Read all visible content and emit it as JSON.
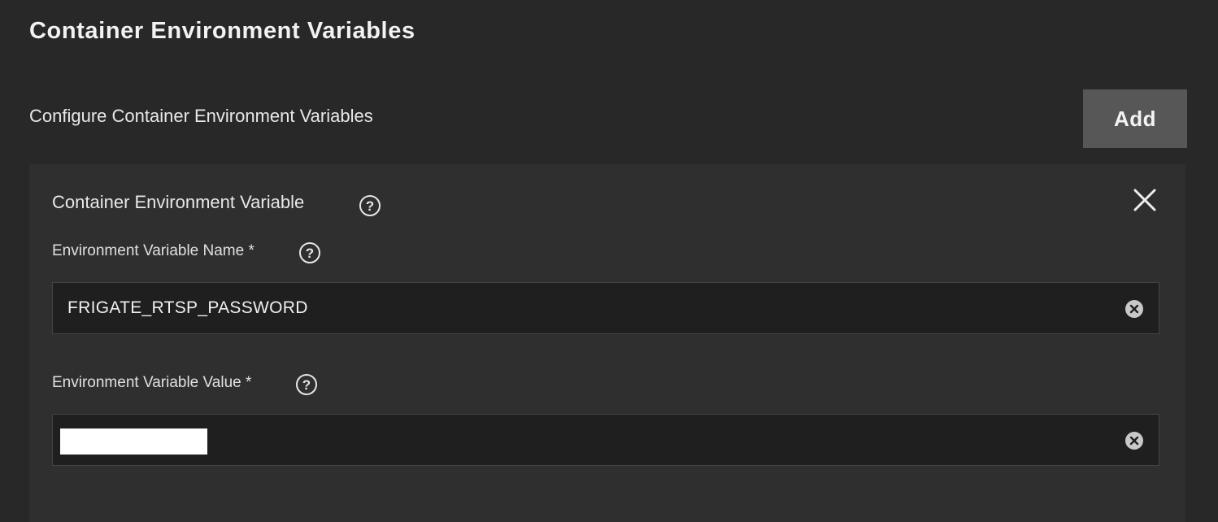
{
  "page": {
    "title": "Container Environment Variables"
  },
  "section": {
    "label": "Configure Container Environment Variables",
    "add_label": "Add"
  },
  "card": {
    "title": "Container Environment Variable",
    "fields": [
      {
        "label": "Environment Variable Name *",
        "value": "FRIGATE_RTSP_PASSWORD"
      },
      {
        "label": "Environment Variable Value *",
        "value": ""
      }
    ]
  },
  "icons": {
    "help": "help-circle-icon",
    "close": "close-icon",
    "clear": "clear-circle-icon"
  },
  "colors": {
    "background": "#282828",
    "card": "#2f2f2f",
    "input": "#1f1f1f",
    "button": "#575757"
  }
}
